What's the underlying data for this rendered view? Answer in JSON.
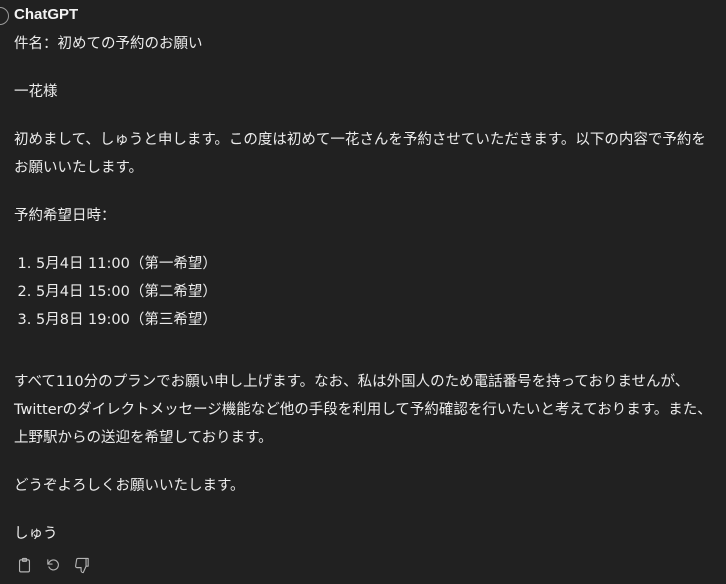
{
  "sender": {
    "name": "ChatGPT"
  },
  "message": {
    "subject": "件名：初めての予約のお願い",
    "salutation": "一花様",
    "intro": "初めまして、しゅうと申します。この度は初めて一花さんを予約させていただきます。以下の内容で予約をお願いいたします。",
    "dates_label": "予約希望日時：",
    "dates": [
      "5月4日 11:00（第一希望）",
      "5月4日 15:00（第二希望）",
      "5月8日 19:00（第三希望）"
    ],
    "details": "すべて110分のプランでお願い申し上げます。なお、私は外国人のため電話番号を持っておりませんが、Twitterのダイレクトメッセージ機能など他の手段を利用して予約確認を行いたいと考えております。また、上野駅からの送迎を希望しております。",
    "closing": "どうぞよろしくお願いいたします。",
    "signature": "しゅう"
  },
  "toolbar": {
    "icons": [
      "clipboard-icon",
      "regenerate-icon",
      "thumbs-down-icon"
    ]
  },
  "colors": {
    "background": "#212121",
    "text": "#ececec",
    "icon": "#b4b4b4"
  }
}
